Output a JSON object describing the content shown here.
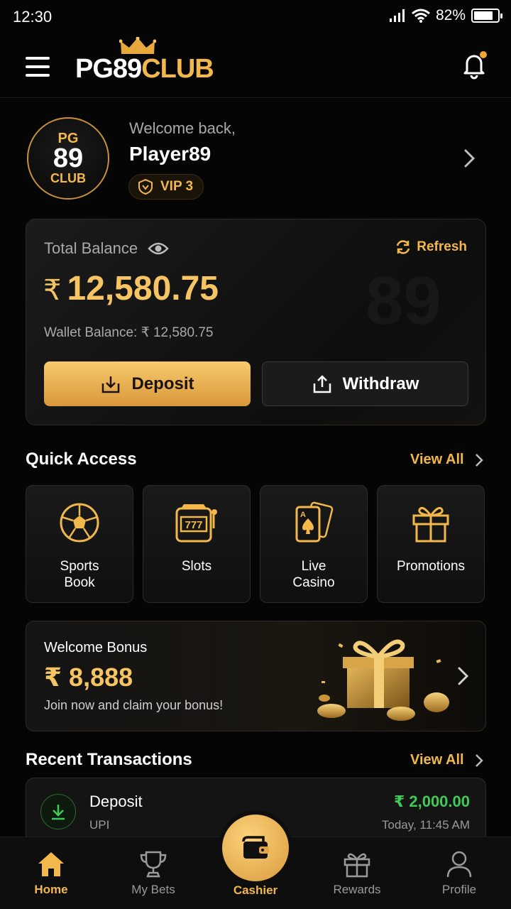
{
  "status_bar": {
    "time": "12:30",
    "battery": "82%",
    "battery_level": 0.82
  },
  "header": {
    "logo_left": "PG",
    "logo_num": "89",
    "logo_right": "CLUB",
    "notification_dot": true
  },
  "profile": {
    "avatar_top": "PG",
    "avatar_mid": "89",
    "avatar_bottom": "CLUB",
    "welcome": "Welcome back,",
    "username": "Player89",
    "vip": "VIP 3"
  },
  "balance": {
    "label": "Total Balance",
    "refresh": "Refresh",
    "currency": "₹",
    "amount": "12,580.75",
    "wallet": "Wallet Balance: ₹ 12,580.75",
    "deposit": "Deposit",
    "withdraw": "Withdraw"
  },
  "quick_access": {
    "title": "Quick Access",
    "view_all": "View All",
    "tiles": [
      {
        "label": "Sports\nBook",
        "icon": "soccer-ball-icon"
      },
      {
        "label": "Slots",
        "icon": "slot-machine-icon"
      },
      {
        "label": "Live\nCasino",
        "icon": "playing-cards-icon"
      },
      {
        "label": "Promotions",
        "icon": "gift-icon"
      }
    ]
  },
  "bonus": {
    "title": "Welcome Bonus",
    "amount": "₹ 8,888",
    "subtitle": "Join now and claim your bonus!"
  },
  "transactions": {
    "title": "Recent Transactions",
    "view_all": "View All",
    "items": [
      {
        "type": "Deposit",
        "method": "UPI",
        "amount": "₹ 2,000.00",
        "time": "Today, 11:45 AM"
      }
    ]
  },
  "bottom_nav": {
    "items": [
      {
        "label": "Home",
        "icon": "home-icon",
        "active": true
      },
      {
        "label": "My Bets",
        "icon": "trophy-icon"
      },
      {
        "label": "Cashier",
        "icon": "wallet-icon"
      },
      {
        "label": "Rewards",
        "icon": "gift-icon"
      },
      {
        "label": "Profile",
        "icon": "user-icon"
      }
    ]
  },
  "colors": {
    "gold": "#F2B84B",
    "background": "#050505",
    "positive": "#3FCB55"
  }
}
